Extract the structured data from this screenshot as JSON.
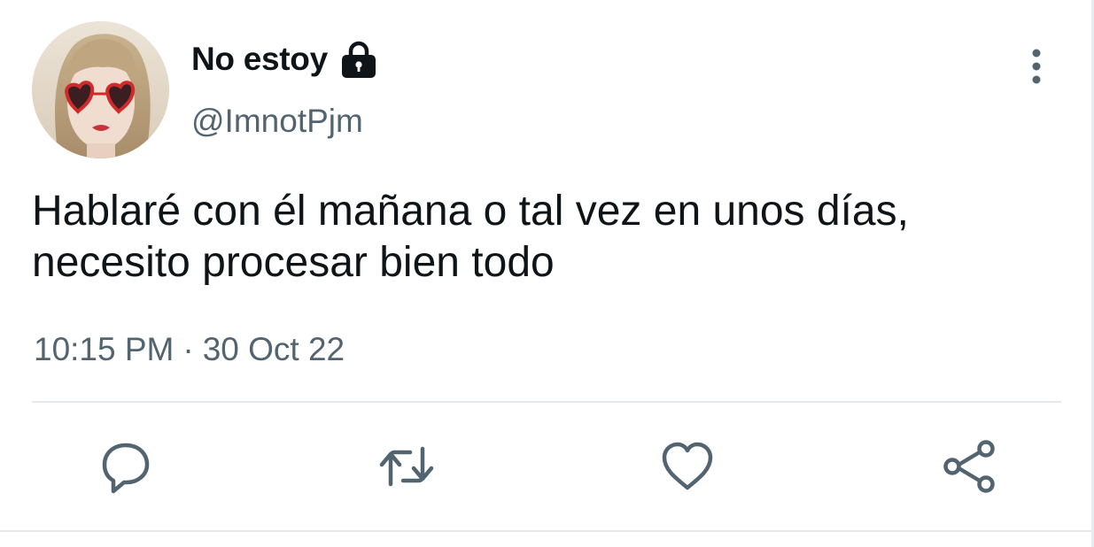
{
  "user": {
    "display_name": "No estoy",
    "handle": "@ImnotPjm",
    "protected_icon": "lock-icon"
  },
  "tweet": {
    "text_lines": [
      "Hablaré con él mañana o tal vez en unos días,",
      "necesito procesar bien todo"
    ],
    "time": "10:15 PM",
    "separator": "·",
    "date": "30 Oct 22"
  },
  "actions": {
    "reply_icon": "reply-icon",
    "retweet_icon": "retweet-icon",
    "like_icon": "heart-icon",
    "share_icon": "share-icon"
  },
  "colors": {
    "text_primary": "#0f1419",
    "text_secondary": "#536471",
    "icon": "#536471"
  }
}
